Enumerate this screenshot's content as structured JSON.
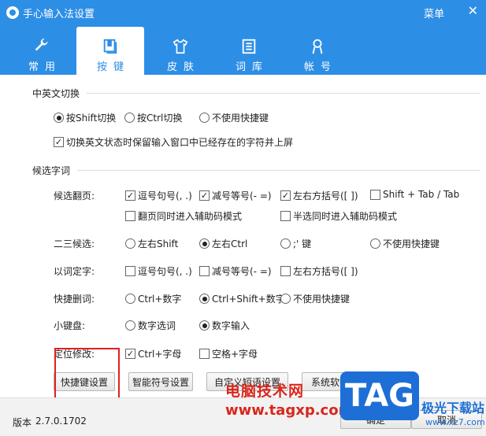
{
  "window": {
    "title": "手心输入法设置",
    "menu_label": "菜单",
    "close_glyph": "✕"
  },
  "tabs": [
    {
      "label": "常用",
      "icon": "wrench-icon"
    },
    {
      "label": "按键",
      "icon": "keyboard-icon",
      "active": true
    },
    {
      "label": "皮肤",
      "icon": "tshirt-icon"
    },
    {
      "label": "词库",
      "icon": "book-icon"
    },
    {
      "label": "帐号",
      "icon": "user-icon"
    }
  ],
  "section_switch": {
    "title": "中英文切换",
    "options": [
      "按Shift切换",
      "按Ctrl切换",
      "不使用快捷键"
    ],
    "selected_index": 0,
    "checkbox_label": "切换英文状态时保留输入窗口中已经存在的字符并上屏",
    "checkbox_checked": true
  },
  "section_candidate": {
    "title": "候选字词",
    "paging": {
      "label": "候选翻页:",
      "options": [
        {
          "text": "逗号句号(, .)",
          "checked": true
        },
        {
          "text": "减号等号(- =)",
          "checked": true
        },
        {
          "text": "左右方括号([ ])",
          "checked": true
        },
        {
          "text": "Shift + Tab / Tab",
          "checked": false
        },
        {
          "text": "翻页同时进入辅助码模式",
          "checked": false
        },
        {
          "text": "半选同时进入辅助码模式",
          "checked": false
        }
      ]
    },
    "second": {
      "label": "二三候选:",
      "options": [
        "左右Shift",
        "左右Ctrl",
        ";' 键",
        "不使用快捷键"
      ],
      "selected_index": 1
    },
    "word_pick": {
      "label": "以词定字:",
      "options": [
        {
          "text": "逗号句号(, .)",
          "checked": false
        },
        {
          "text": "减号等号(- =)",
          "checked": false
        },
        {
          "text": "左右方括号([ ])",
          "checked": false
        }
      ]
    },
    "delete_word": {
      "label": "快捷删词:",
      "options": [
        "Ctrl+数字",
        "Ctrl+Shift+数字",
        "不使用快捷键"
      ],
      "selected_index": 1
    },
    "keypad": {
      "label": "小键盘:",
      "options": [
        "数字选词",
        "数字输入"
      ],
      "selected_index": 1
    },
    "locate": {
      "label": "定位修改:",
      "options": [
        {
          "text": "Ctrl+字母",
          "checked": true
        },
        {
          "text": "空格+字母",
          "checked": false
        }
      ]
    }
  },
  "buttons": {
    "shortcut": "快捷键设置",
    "symbol": "智能符号设置",
    "custom_phrase": "自定义短语设置",
    "soft_kb": "系统软键盘布局设置"
  },
  "footer": {
    "version_label": "版本",
    "version": "2.7.0.1702",
    "ok": "确定",
    "cancel": "取消"
  },
  "watermark": {
    "cn": "电脑技术网",
    "url": "www.tagxp.com",
    "tag": "TAG",
    "site": "极光下载站",
    "site_url": "www.xz7.com"
  },
  "colors": {
    "header": "#2d8ee6",
    "highlight": "#e02020"
  }
}
